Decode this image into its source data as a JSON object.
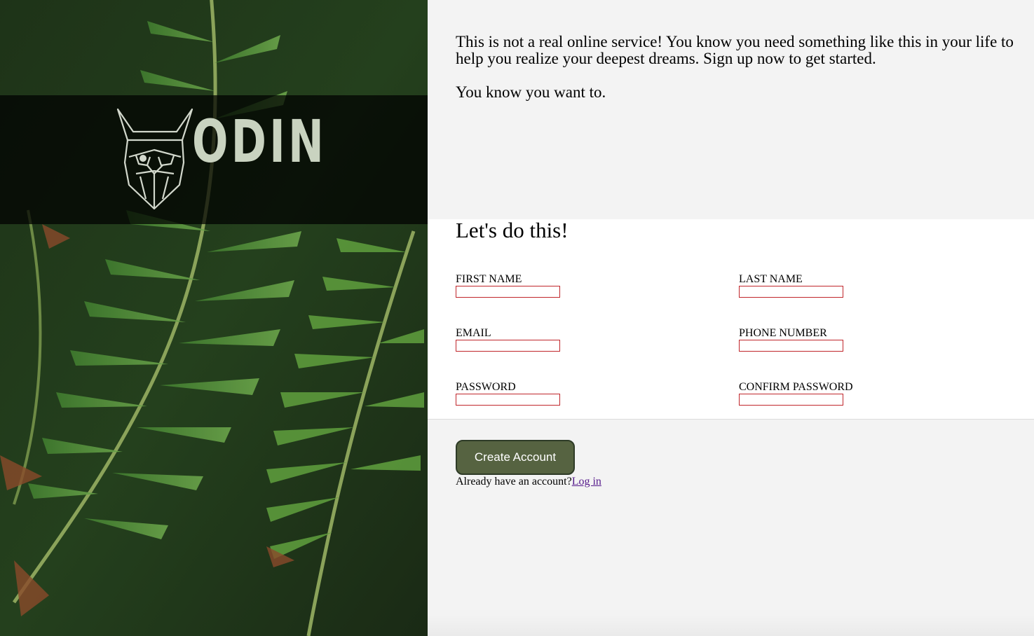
{
  "brand": {
    "logo_text": "ODIN",
    "icon": "viking-helmet-icon"
  },
  "intro": {
    "paragraph1": "This is not a real online service! You know you need something like this in your life to help you realize your deepest dreams. Sign up now to get started.",
    "paragraph2": "You know you want to."
  },
  "form": {
    "heading": "Let's do this!",
    "fields": {
      "first_name": {
        "label": "First Name",
        "value": ""
      },
      "last_name": {
        "label": "Last Name",
        "value": ""
      },
      "email": {
        "label": "Email",
        "value": ""
      },
      "phone": {
        "label": "Phone Number",
        "value": ""
      },
      "password": {
        "label": "Password",
        "value": ""
      },
      "confirm_password": {
        "label": "Confirm Password",
        "value": ""
      }
    }
  },
  "actions": {
    "create_label": "Create Account",
    "login_prompt": "Already have an account?",
    "login_link": "Log in"
  },
  "colors": {
    "button_bg": "#566341",
    "input_border": "#c0262b",
    "link": "#551a8b"
  }
}
